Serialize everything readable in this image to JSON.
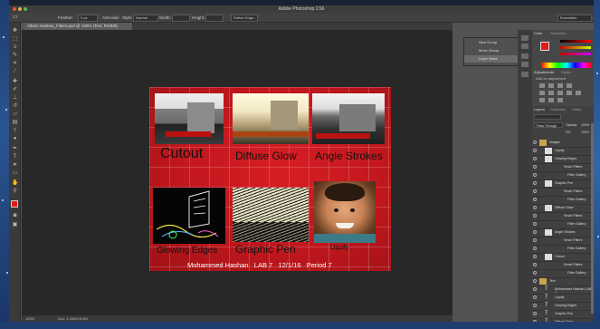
{
  "window": {
    "title": "Adobe Photoshop CS6",
    "workspace": "Essentials"
  },
  "options": {
    "feather_label": "Feather:",
    "feather_value": "0 px",
    "antialias": "Anti-alias",
    "style_label": "Style:",
    "style_value": "Normal",
    "width_label": "Width:",
    "height_label": "Height:",
    "refine_edge": "Refine Edge..."
  },
  "document": {
    "tab": "Album Hashan_Filters.psd @ 100% (Text, RGB/8)",
    "zoom": "100%",
    "doc_size": "Doc: 1.39M/15.5M"
  },
  "tools": [
    "move",
    "marquee",
    "lasso",
    "quick-select",
    "crop",
    "eyedropper",
    "healing",
    "brush",
    "stamp",
    "history-brush",
    "eraser",
    "gradient",
    "blur",
    "dodge",
    "pen",
    "type",
    "path-select",
    "shape",
    "hand",
    "zoom"
  ],
  "poster": {
    "panels": [
      {
        "caption": "Cutout",
        "style": "cutout"
      },
      {
        "caption": "Diffuse Glow",
        "style": "glow"
      },
      {
        "caption": "Angle Strokes",
        "style": "angle"
      },
      {
        "caption": "Glowing Edges",
        "style": "edges"
      },
      {
        "caption": "Graphic Pen",
        "style": "pen"
      },
      {
        "caption": "Liquify",
        "style": "liquify"
      }
    ],
    "footer": "Mohammed Hashan   LAB 7   12/1/16   Period 7"
  },
  "history": {
    "items": [
      "New Group",
      "Move Group",
      "Layer Mask"
    ]
  },
  "panels_right": {
    "color_tab": "Color",
    "swatches_tab": "Swatches",
    "adjustments_tab": "Adjustments",
    "styles_tab": "Styles",
    "add_adjustment": "Add an adjustment",
    "layers_tab": "Layers",
    "channels_tab": "Channels",
    "paths_tab": "Paths",
    "blend_mode": "Pass Through",
    "opacity_label": "Opacity:",
    "opacity_value": "100%",
    "fill_label": "Fill:",
    "fill_value": "100%",
    "layers": [
      {
        "name": "Images",
        "kind": "group"
      },
      {
        "name": "Liquify",
        "kind": "layer"
      },
      {
        "name": "Glowing Edges",
        "kind": "layer"
      },
      {
        "name": "Smart Filters",
        "kind": "sub"
      },
      {
        "name": "Filter Gallery",
        "kind": "sub2"
      },
      {
        "name": "Graphic Pen",
        "kind": "layer"
      },
      {
        "name": "Smart Filters",
        "kind": "sub"
      },
      {
        "name": "Filter Gallery",
        "kind": "sub2"
      },
      {
        "name": "Diffuse Glow",
        "kind": "layer"
      },
      {
        "name": "Smart Filters",
        "kind": "sub"
      },
      {
        "name": "Filter Gallery",
        "kind": "sub2"
      },
      {
        "name": "Angle Strokes",
        "kind": "layer"
      },
      {
        "name": "Smart Filters",
        "kind": "sub"
      },
      {
        "name": "Filter Gallery",
        "kind": "sub2"
      },
      {
        "name": "Cutout",
        "kind": "layer"
      },
      {
        "name": "Smart Filters",
        "kind": "sub"
      },
      {
        "name": "Filter Gallery",
        "kind": "sub2"
      },
      {
        "name": "Text",
        "kind": "group"
      },
      {
        "name": "Mohammed Hashan LAB 7",
        "kind": "text"
      },
      {
        "name": "Liquify",
        "kind": "text"
      },
      {
        "name": "Glowing Edges",
        "kind": "text"
      },
      {
        "name": "Graphic Pen",
        "kind": "text"
      },
      {
        "name": "Diffuse Glow",
        "kind": "text"
      }
    ]
  },
  "colors": {
    "foreground": "#e01b1b",
    "poster_red": "#c8191f",
    "app_bg": "#535353"
  }
}
